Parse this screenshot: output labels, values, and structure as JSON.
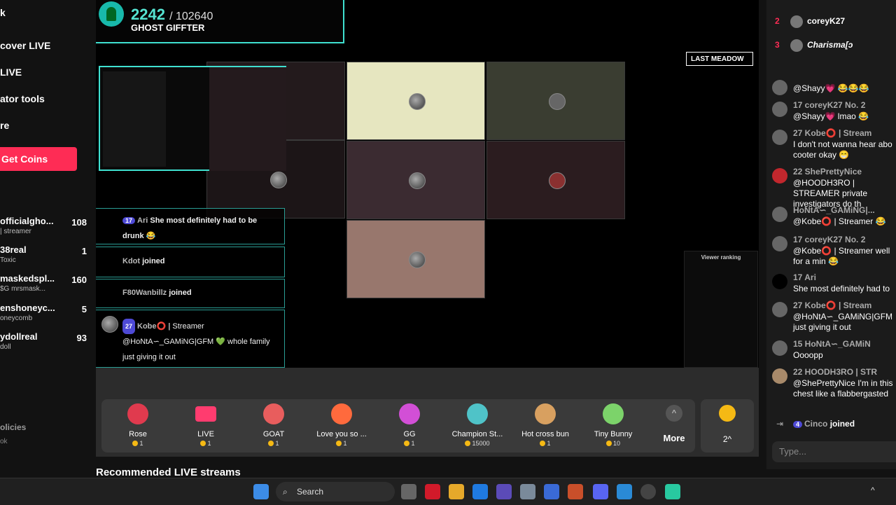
{
  "left_nav": {
    "items": [
      "k",
      "cover LIVE",
      "LIVE",
      "ator tools",
      "re"
    ],
    "get_coins": "Get Coins",
    "suggested": [
      {
        "name": "officialgho...",
        "sub": "| streamer",
        "count": "108"
      },
      {
        "name": "38real",
        "sub": "Toxic",
        "count": "1"
      },
      {
        "name": "maskedspl...",
        "sub": "$G mrsmask...",
        "count": "160"
      },
      {
        "name": "enshoneyc...",
        "sub": "oneycomb",
        "count": "5"
      },
      {
        "name": "ydollreal",
        "sub": "doll",
        "count": "93"
      }
    ],
    "footer_policies": "olicies",
    "footer_sub": "ok"
  },
  "stream": {
    "gift_banner": {
      "count": "2242",
      "total": "/ 102640",
      "label": "GHOST GIFFTER"
    },
    "last_meadow": "LAST MEADOW",
    "overlay_chat": [
      {
        "badge": "17",
        "user": "Ari",
        "text": "She most definitely had to be drunk 😂"
      },
      {
        "user": "Kdot",
        "text": "joined"
      },
      {
        "user": "F80Wanbillz",
        "text": "joined"
      },
      {
        "badge": "27",
        "user": "Kobe⭕ |",
        "text": "Streamer @HoNtA∽_GAMiNG|GFM 💚 whole family just giving it out"
      }
    ],
    "viewer_ranking_title": "Viewer ranking"
  },
  "gifts": [
    {
      "name": "Rose",
      "price": "1",
      "color": "#e03a4e"
    },
    {
      "name": "LIVE",
      "price": "1",
      "color": "#ff3c6f"
    },
    {
      "name": "GOAT",
      "price": "1",
      "color": "#e85d5d"
    },
    {
      "name": "Love you so ...",
      "price": "1",
      "color": "#ff6a3d"
    },
    {
      "name": "GG",
      "price": "1",
      "color": "#d24fd6"
    },
    {
      "name": "Champion St...",
      "price": "15000",
      "color": "#4fc3c8"
    },
    {
      "name": "Hot cross bun",
      "price": "1",
      "color": "#d8a060"
    },
    {
      "name": "Tiny Bunny",
      "price": "10",
      "color": "#7cd36a"
    }
  ],
  "more_label": "More",
  "coin_panel": {
    "count": "2",
    "arrow": "^"
  },
  "recommended": "Recommended LIVE streams",
  "chat": {
    "ranking": [
      {
        "rank": "2",
        "name": "coreyK27"
      },
      {
        "rank": "3",
        "name": "Charisma[ↄ"
      }
    ],
    "messages": [
      {
        "header": "@Shayy💗 😂😂😂",
        "text": ""
      },
      {
        "header": "17 coreyK27 No. 2",
        "text": "@Shayy💗 lmao 😂"
      },
      {
        "header": "27 Kobe⭕ | Stream",
        "text": "I don't not wanna hear abo cooter okay 😁"
      },
      {
        "header": "22 ShePrettyNice",
        "text": "@HOODH3RO | STREAMER private investigators do th"
      },
      {
        "header": "HoNtA∽_GAMiNG|...",
        "text": "@Kobe⭕ | Streamer 😂"
      },
      {
        "header": "17 coreyK27 No. 2",
        "text": "@Kobe⭕ | Streamer well for a min 😂"
      },
      {
        "header": "17 Ari",
        "text": "She most definitely had to"
      },
      {
        "header": "27 Kobe⭕ | Stream",
        "text": "@HoNtA∽_GAMiNG|GFM just giving it out"
      },
      {
        "header": "15 HoNtA∽_GAMiN",
        "text": "Oooopp"
      },
      {
        "header": "22 HOODH3RO | STR",
        "text": "@ShePrettyNice I'm in this chest like a flabbergasted"
      }
    ],
    "join_line": {
      "badge": "4",
      "user": "Cinco",
      "text": "joined"
    },
    "placeholder": "Type..."
  },
  "taskbar": {
    "search": "Search"
  }
}
